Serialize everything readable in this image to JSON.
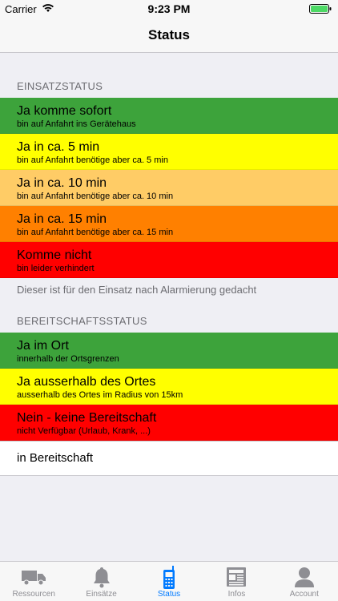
{
  "status_bar": {
    "carrier": "Carrier",
    "time": "9:23 PM"
  },
  "nav": {
    "title": "Status"
  },
  "einsatz": {
    "header": "EINSATZSTATUS",
    "items": [
      {
        "title": "Ja komme sofort",
        "subtitle": "bin auf Anfahrt ins Gerätehaus",
        "color": "#3da33b"
      },
      {
        "title": "Ja in ca. 5 min",
        "subtitle": "bin auf Anfahrt benötige aber ca. 5 min",
        "color": "#ffff00"
      },
      {
        "title": "Ja in ca. 10 min",
        "subtitle": "bin auf Anfahrt benötige aber ca. 10 min",
        "color": "#ffcc66"
      },
      {
        "title": "Ja in ca. 15 min",
        "subtitle": "bin auf Anfahrt benötige aber ca. 15 min",
        "color": "#ff8000"
      },
      {
        "title": "Komme nicht",
        "subtitle": "bin leider verhindert",
        "color": "#ff0000"
      }
    ],
    "footer": "Dieser ist für den Einsatz nach Alarmierung gedacht"
  },
  "bereitschaft": {
    "header": "BEREITSCHAFTSSTATUS",
    "items": [
      {
        "title": "Ja im Ort",
        "subtitle": "innerhalb der Ortsgrenzen",
        "color": "#3da33b"
      },
      {
        "title": "Ja ausserhalb des Ortes",
        "subtitle": "ausserhalb des Ortes im Radius von 15km",
        "color": "#ffff00"
      },
      {
        "title": "Nein - keine Bereitschaft",
        "subtitle": "nicht Verfügbar (Urlaub, Krank, ...)",
        "color": "#ff0000"
      }
    ],
    "current": "in Bereitschaft"
  },
  "tabs": [
    {
      "label": "Ressourcen",
      "icon": "truck-icon",
      "active": false
    },
    {
      "label": "Einsätze",
      "icon": "bell-icon",
      "active": false
    },
    {
      "label": "Status",
      "icon": "radio-icon",
      "active": true
    },
    {
      "label": "Infos",
      "icon": "newspaper-icon",
      "active": false
    },
    {
      "label": "Account",
      "icon": "person-icon",
      "active": false
    }
  ],
  "colors": {
    "accent": "#007aff",
    "inactive": "#8e8e93"
  }
}
